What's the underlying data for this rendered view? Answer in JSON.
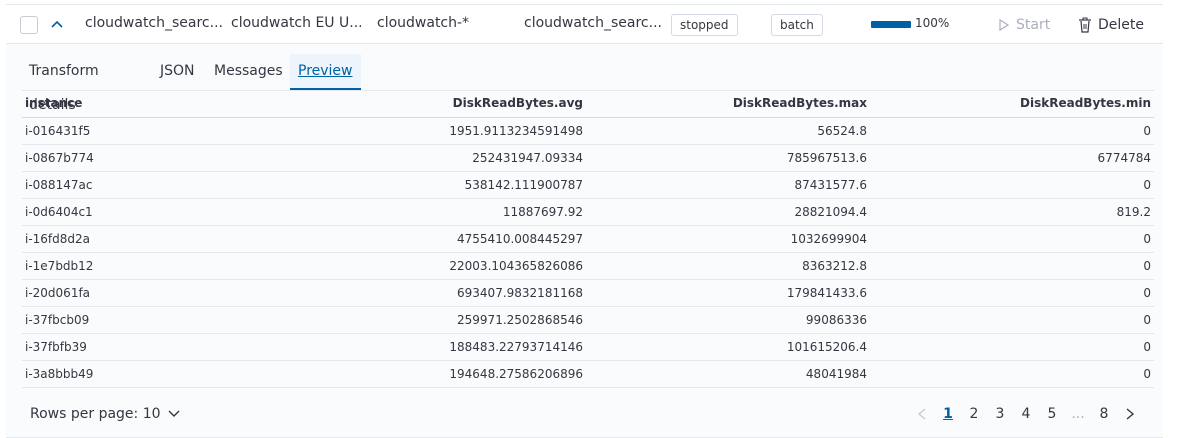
{
  "transform_row": {
    "id": "cloudwatch_searc...",
    "description": "cloudwatch EU U...",
    "source_index": "cloudwatch-*",
    "dest_index": "cloudwatch_searc...",
    "status": "stopped",
    "mode": "batch",
    "progress": 1.0,
    "progress_label": "100%",
    "start_label": "Start",
    "delete_label": "Delete"
  },
  "tabs": [
    {
      "label": "Transform details"
    },
    {
      "label": "JSON"
    },
    {
      "label": "Messages"
    },
    {
      "label": "Preview"
    }
  ],
  "active_tab": "Preview",
  "table": {
    "columns": [
      "instance",
      "DiskReadBytes.avg",
      "DiskReadBytes.max",
      "DiskReadBytes.min"
    ],
    "rows": [
      [
        "i-016431f5",
        "1951.9113234591498",
        "56524.8",
        "0"
      ],
      [
        "i-0867b774",
        "252431947.09334",
        "785967513.6",
        "6774784"
      ],
      [
        "i-088147ac",
        "538142.111900787",
        "87431577.6",
        "0"
      ],
      [
        "i-0d6404c1",
        "11887697.92",
        "28821094.4",
        "819.2"
      ],
      [
        "i-16fd8d2a",
        "4755410.008445297",
        "1032699904",
        "0"
      ],
      [
        "i-1e7bdb12",
        "22003.104365826086",
        "8363212.8",
        "0"
      ],
      [
        "i-20d061fa",
        "693407.9832181168",
        "179841433.6",
        "0"
      ],
      [
        "i-37fbcb09",
        "259971.2502868546",
        "99086336",
        "0"
      ],
      [
        "i-37fbfb39",
        "188483.22793714146",
        "101615206.4",
        "0"
      ],
      [
        "i-3a8bbb49",
        "194648.27586206896",
        "48041984",
        "0"
      ]
    ]
  },
  "footer": {
    "rows_per_page_label": "Rows per page: 10",
    "pages": [
      "1",
      "2",
      "3",
      "4",
      "5",
      "...",
      "8"
    ],
    "current_page": "1"
  },
  "colors": {
    "accent": "#0061a6",
    "progress": "#0061a6"
  }
}
